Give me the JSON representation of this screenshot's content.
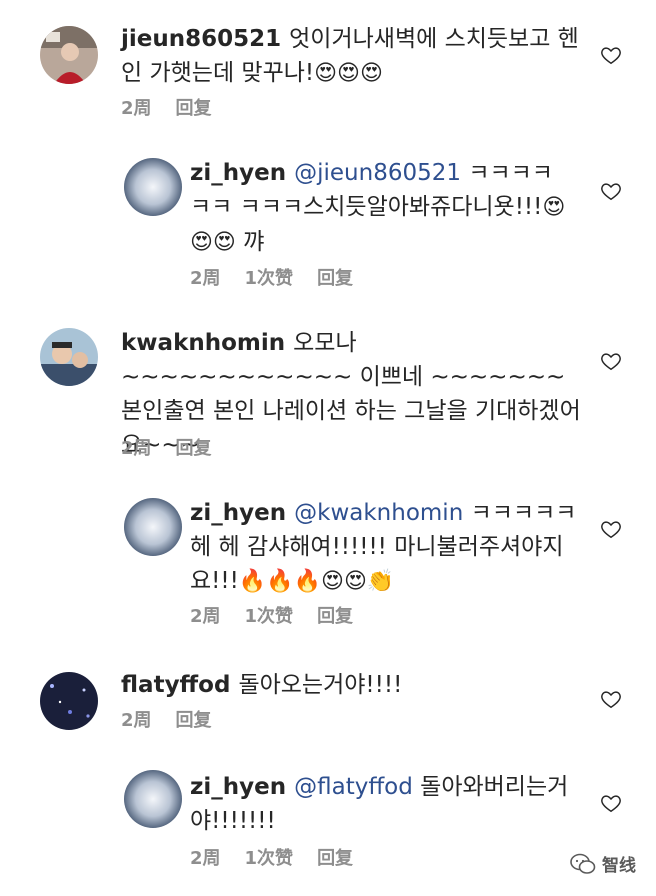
{
  "comments": [
    {
      "user": "jieun860521",
      "text": "엇이거나새벽에 스치듯보고 헨인 가햇는데 맞꾸나!",
      "emojis": "😍😍😍",
      "time": "2周",
      "reply": "回复"
    },
    {
      "user": "zi_hyen",
      "mention": "@jieun860521",
      "text": " ㅋㅋㅋㅋㅋㅋ ㅋㅋㅋ스치듯알아봐쥬다니욧!!!",
      "emojis": "😍😍😍",
      "tail": " 꺄",
      "time": "2周",
      "likes": "1次赞",
      "reply": "回复"
    },
    {
      "user": "kwaknhomin",
      "text": "오모나~~~~~~~~~~~~ 이쁘네 ~~~~~~~ 본인출연 본인 나레이션 하는 그날을 기대하겠어요~~~",
      "time": "2周",
      "reply": "回复"
    },
    {
      "user": "zi_hyen",
      "mention": "@kwaknhomin",
      "text": " ㅋㅋㅋㅋㅋ헤 헤 감샤해여!!!!!! 마니불러주셔야지요!!!",
      "emojis": "🔥🔥🔥😍😍👏",
      "time": "2周",
      "likes": "1次赞",
      "reply": "回复"
    },
    {
      "user": "flatyffod",
      "text": "돌아오는거야!!!!",
      "time": "2周",
      "reply": "回复"
    },
    {
      "user": "zi_hyen",
      "mention": "@flatyffod",
      "text": " 돌아와버리는거 야!!!!!!!",
      "time": "2周",
      "likes": "1次赞",
      "reply": "回复"
    }
  ],
  "watermark": {
    "label": "智线"
  }
}
